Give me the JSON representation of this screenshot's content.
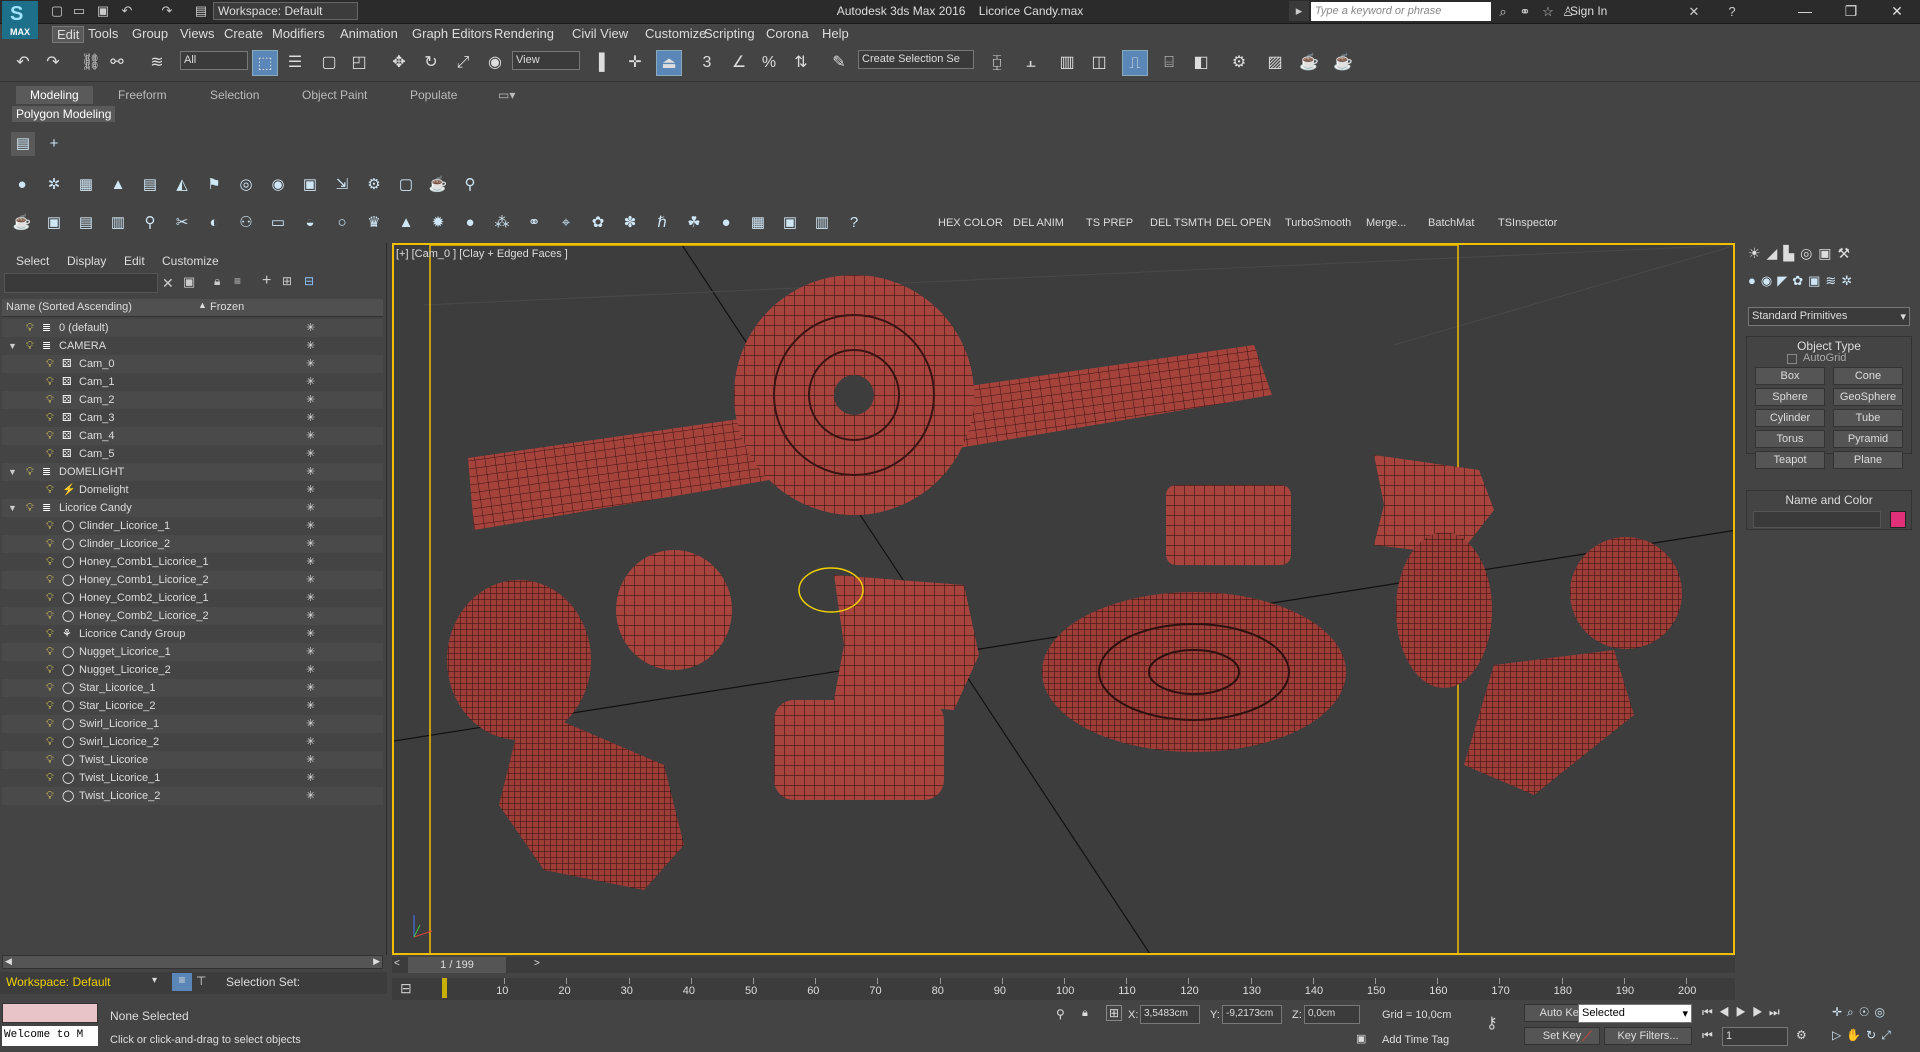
{
  "title_bar": {
    "workspace": "Workspace: Default",
    "app": "Autodesk 3ds Max 2016",
    "file": "Licorice Candy.max",
    "search_placeholder": "Type a keyword or phrase",
    "sign_in": "Sign In",
    "logo_text": "MAX"
  },
  "menus": [
    "Edit",
    "Tools",
    "Group",
    "Views",
    "Create",
    "Modifiers",
    "Animation",
    "Graph Editors",
    "Rendering",
    "Civil View",
    "Customize",
    "Scripting",
    "Corona",
    "Help"
  ],
  "main_toolbar": {
    "selection_filter": "All",
    "ref_coord": "View",
    "selection_set": "Create Selection Se"
  },
  "ribbon": {
    "tabs": [
      "Modeling",
      "Freeform",
      "Selection",
      "Object Paint",
      "Populate"
    ],
    "active_panel": "Polygon Modeling"
  },
  "custom_buttons": [
    "HEX COLOR",
    "DEL ANIM",
    "TS PREP",
    "DEL TSMTH",
    "DEL OPEN",
    "TurboSmooth",
    "Merge...",
    "BatchMat",
    "TSInspector"
  ],
  "scene_explorer": {
    "menu": [
      "Select",
      "Display",
      "Edit",
      "Customize"
    ],
    "columns": {
      "name": "Name (Sorted Ascending)",
      "frozen": "Frozen"
    },
    "rows": [
      {
        "name": "0 (default)",
        "level": 0,
        "type": "layer"
      },
      {
        "name": "CAMERA",
        "level": 0,
        "type": "layer",
        "expand": true
      },
      {
        "name": "Cam_0",
        "level": 1,
        "type": "camera"
      },
      {
        "name": "Cam_1",
        "level": 1,
        "type": "camera"
      },
      {
        "name": "Cam_2",
        "level": 1,
        "type": "camera"
      },
      {
        "name": "Cam_3",
        "level": 1,
        "type": "camera"
      },
      {
        "name": "Cam_4",
        "level": 1,
        "type": "camera"
      },
      {
        "name": "Cam_5",
        "level": 1,
        "type": "camera"
      },
      {
        "name": "DOMELIGHT",
        "level": 0,
        "type": "layer",
        "expand": true
      },
      {
        "name": "Domelight",
        "level": 1,
        "type": "light"
      },
      {
        "name": "Licorice Candy",
        "level": 0,
        "type": "layer",
        "expand": true
      },
      {
        "name": "Clinder_Licorice_1",
        "level": 1,
        "type": "geo"
      },
      {
        "name": "Clinder_Licorice_2",
        "level": 1,
        "type": "geo"
      },
      {
        "name": "Honey_Comb1_Licorice_1",
        "level": 1,
        "type": "geo"
      },
      {
        "name": "Honey_Comb1_Licorice_2",
        "level": 1,
        "type": "geo"
      },
      {
        "name": "Honey_Comb2_Licorice_1",
        "level": 1,
        "type": "geo"
      },
      {
        "name": "Honey_Comb2_Licorice_2",
        "level": 1,
        "type": "geo"
      },
      {
        "name": "Licorice Candy Group",
        "level": 1,
        "type": "group"
      },
      {
        "name": "Nugget_Licorice_1",
        "level": 1,
        "type": "geo"
      },
      {
        "name": "Nugget_Licorice_2",
        "level": 1,
        "type": "geo"
      },
      {
        "name": "Star_Licorice_1",
        "level": 1,
        "type": "geo"
      },
      {
        "name": "Star_Licorice_2",
        "level": 1,
        "type": "geo"
      },
      {
        "name": "Swirl_Licorice_1",
        "level": 1,
        "type": "geo"
      },
      {
        "name": "Swirl_Licorice_2",
        "level": 1,
        "type": "geo"
      },
      {
        "name": "Twist_Licorice",
        "level": 1,
        "type": "geo"
      },
      {
        "name": "Twist_Licorice_1",
        "level": 1,
        "type": "geo"
      },
      {
        "name": "Twist_Licorice_2",
        "level": 1,
        "type": "geo"
      }
    ],
    "workspace": "Workspace: Default",
    "selection_set_label": "Selection Set:"
  },
  "viewport": {
    "label": "[+] [Cam_0 ] [Clay + Edged Faces ]"
  },
  "command_panel": {
    "category": "Standard Primitives",
    "object_type_title": "Object Type",
    "autogrid": "AutoGrid",
    "buttons": [
      "Box",
      "Cone",
      "Sphere",
      "GeoSphere",
      "Cylinder",
      "Tube",
      "Torus",
      "Pyramid",
      "Teapot",
      "Plane"
    ],
    "name_color_title": "Name and Color",
    "swatch_color": "#e0307a"
  },
  "timeline": {
    "frame": "1 / 199",
    "ticks": [
      "10",
      "20",
      "30",
      "40",
      "50",
      "60",
      "70",
      "80",
      "90",
      "100",
      "110",
      "120",
      "130",
      "140",
      "150",
      "160",
      "170",
      "180",
      "190",
      "200"
    ]
  },
  "status": {
    "welcome": "Welcome to M",
    "selected": "None Selected",
    "hint": "Click or click-and-drag to select objects",
    "x_label": "X:",
    "x": "3,5483cm",
    "y_label": "Y:",
    "y": "-9,2173cm",
    "z_label": "Z:",
    "z": "0,0cm",
    "grid": "Grid = 10,0cm",
    "add_time_tag": "Add Time Tag",
    "auto_key": "Auto Key",
    "set_key": "Set Key",
    "key_mode": "Selected",
    "key_filters": "Key Filters...",
    "frame_field": "1"
  }
}
